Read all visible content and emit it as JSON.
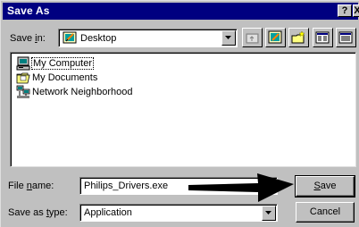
{
  "window": {
    "title": "Save As",
    "help_label": "?",
    "close_label": "X"
  },
  "save_in": {
    "label_prefix": "Save ",
    "label_hotkey": "i",
    "label_suffix": "n:",
    "value": "Desktop"
  },
  "toolbar": {
    "buttons": [
      {
        "name": "up-one-level-icon"
      },
      {
        "name": "desktop-icon"
      },
      {
        "name": "create-new-folder-icon"
      },
      {
        "name": "list-view-icon"
      },
      {
        "name": "details-view-icon"
      }
    ]
  },
  "files": [
    {
      "label": "My Computer",
      "icon": "my-computer-icon",
      "selected": true
    },
    {
      "label": "My Documents",
      "icon": "folder-icon",
      "selected": false
    },
    {
      "label": "Network Neighborhood",
      "icon": "network-neighborhood-icon",
      "selected": false
    }
  ],
  "file_name": {
    "label_prefix": "File ",
    "label_hotkey": "n",
    "label_suffix": "ame:",
    "value": "Philips_Drivers.exe"
  },
  "save_as_type": {
    "label_prefix": "Save as ",
    "label_hotkey": "t",
    "label_suffix": "ype:",
    "value": "Application"
  },
  "buttons": {
    "save": {
      "hotkey": "S",
      "rest": "ave"
    },
    "cancel": {
      "label": "Cancel"
    }
  },
  "colors": {
    "titlebar": "#000080",
    "face": "#c0c0c0",
    "arrow": "#000000"
  }
}
